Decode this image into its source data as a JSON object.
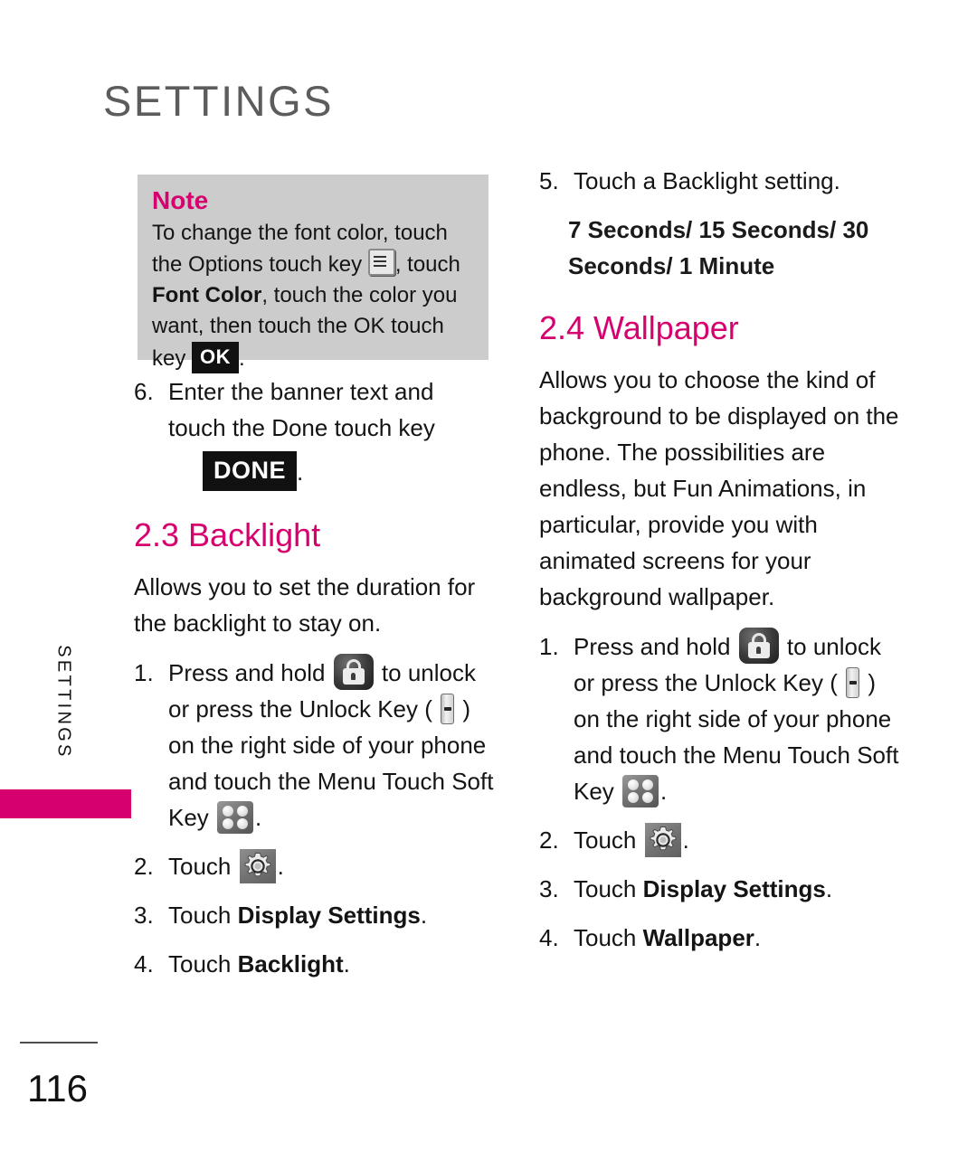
{
  "header": {
    "title": "SETTINGS"
  },
  "side_tab": {
    "label": "SETTINGS",
    "accent_color": "#d6006e"
  },
  "note": {
    "title": "Note",
    "text_part_1": "To change the font color, touch the Options touch key",
    "text_part_2": ", touch ",
    "bold_1": "Font Color",
    "text_part_3": ", touch the color you want, then touch the OK touch key",
    "ok_key_label": "OK",
    "text_part_4": ".",
    "options_icon": "options-list-icon",
    "background_color": "#cccccc"
  },
  "left_column": {
    "step6": {
      "number": "6.",
      "text": "Enter the banner text and touch the Done touch key",
      "done_key_label": "DONE",
      "trailing": "."
    },
    "section_backlight": {
      "heading": "2.3 Backlight",
      "intro": "Allows you to set the duration for the backlight to stay on.",
      "steps": [
        {
          "number": "1.",
          "t1": "Press and hold",
          "t2": "to unlock or press the Unlock Key (",
          "t3": ") on the right side of your phone and touch the Menu Touch Soft Key",
          "t4": ".",
          "icons": [
            "lock-icon",
            "side-unlock-key-icon",
            "menu-grid-icon"
          ]
        },
        {
          "number": "2.",
          "t1": "Touch",
          "t2": ".",
          "icons": [
            "gear-icon"
          ]
        },
        {
          "number": "3.",
          "t1": "Touch ",
          "bold": "Display Settings",
          "t2": "."
        },
        {
          "number": "4.",
          "t1": "Touch ",
          "bold": "Backlight",
          "t2": "."
        }
      ]
    }
  },
  "right_column": {
    "step5": {
      "number": "5.",
      "text": "Touch a Backlight setting.",
      "options": "7 Seconds/ 15 Seconds/ 30 Seconds/ 1 Minute"
    },
    "section_wallpaper": {
      "heading": "2.4 Wallpaper",
      "intro": "Allows you to choose the kind of background to be displayed on the phone. The possibilities are endless, but Fun Animations, in particular, provide you with animated screens for your background wallpaper.",
      "steps": [
        {
          "number": "1.",
          "t1": "Press and hold",
          "t2": "to unlock or press the Unlock Key (",
          "t3": ") on the right side of your phone and touch the Menu Touch Soft Key",
          "t4": ".",
          "icons": [
            "lock-icon",
            "side-unlock-key-icon",
            "menu-grid-icon"
          ]
        },
        {
          "number": "2.",
          "t1": "Touch",
          "t2": ".",
          "icons": [
            "gear-icon"
          ]
        },
        {
          "number": "3.",
          "t1": "Touch ",
          "bold": "Display Settings",
          "t2": "."
        },
        {
          "number": "4.",
          "t1": "Touch ",
          "bold": "Wallpaper",
          "t2": "."
        }
      ]
    }
  },
  "footer": {
    "page_number": "116"
  }
}
